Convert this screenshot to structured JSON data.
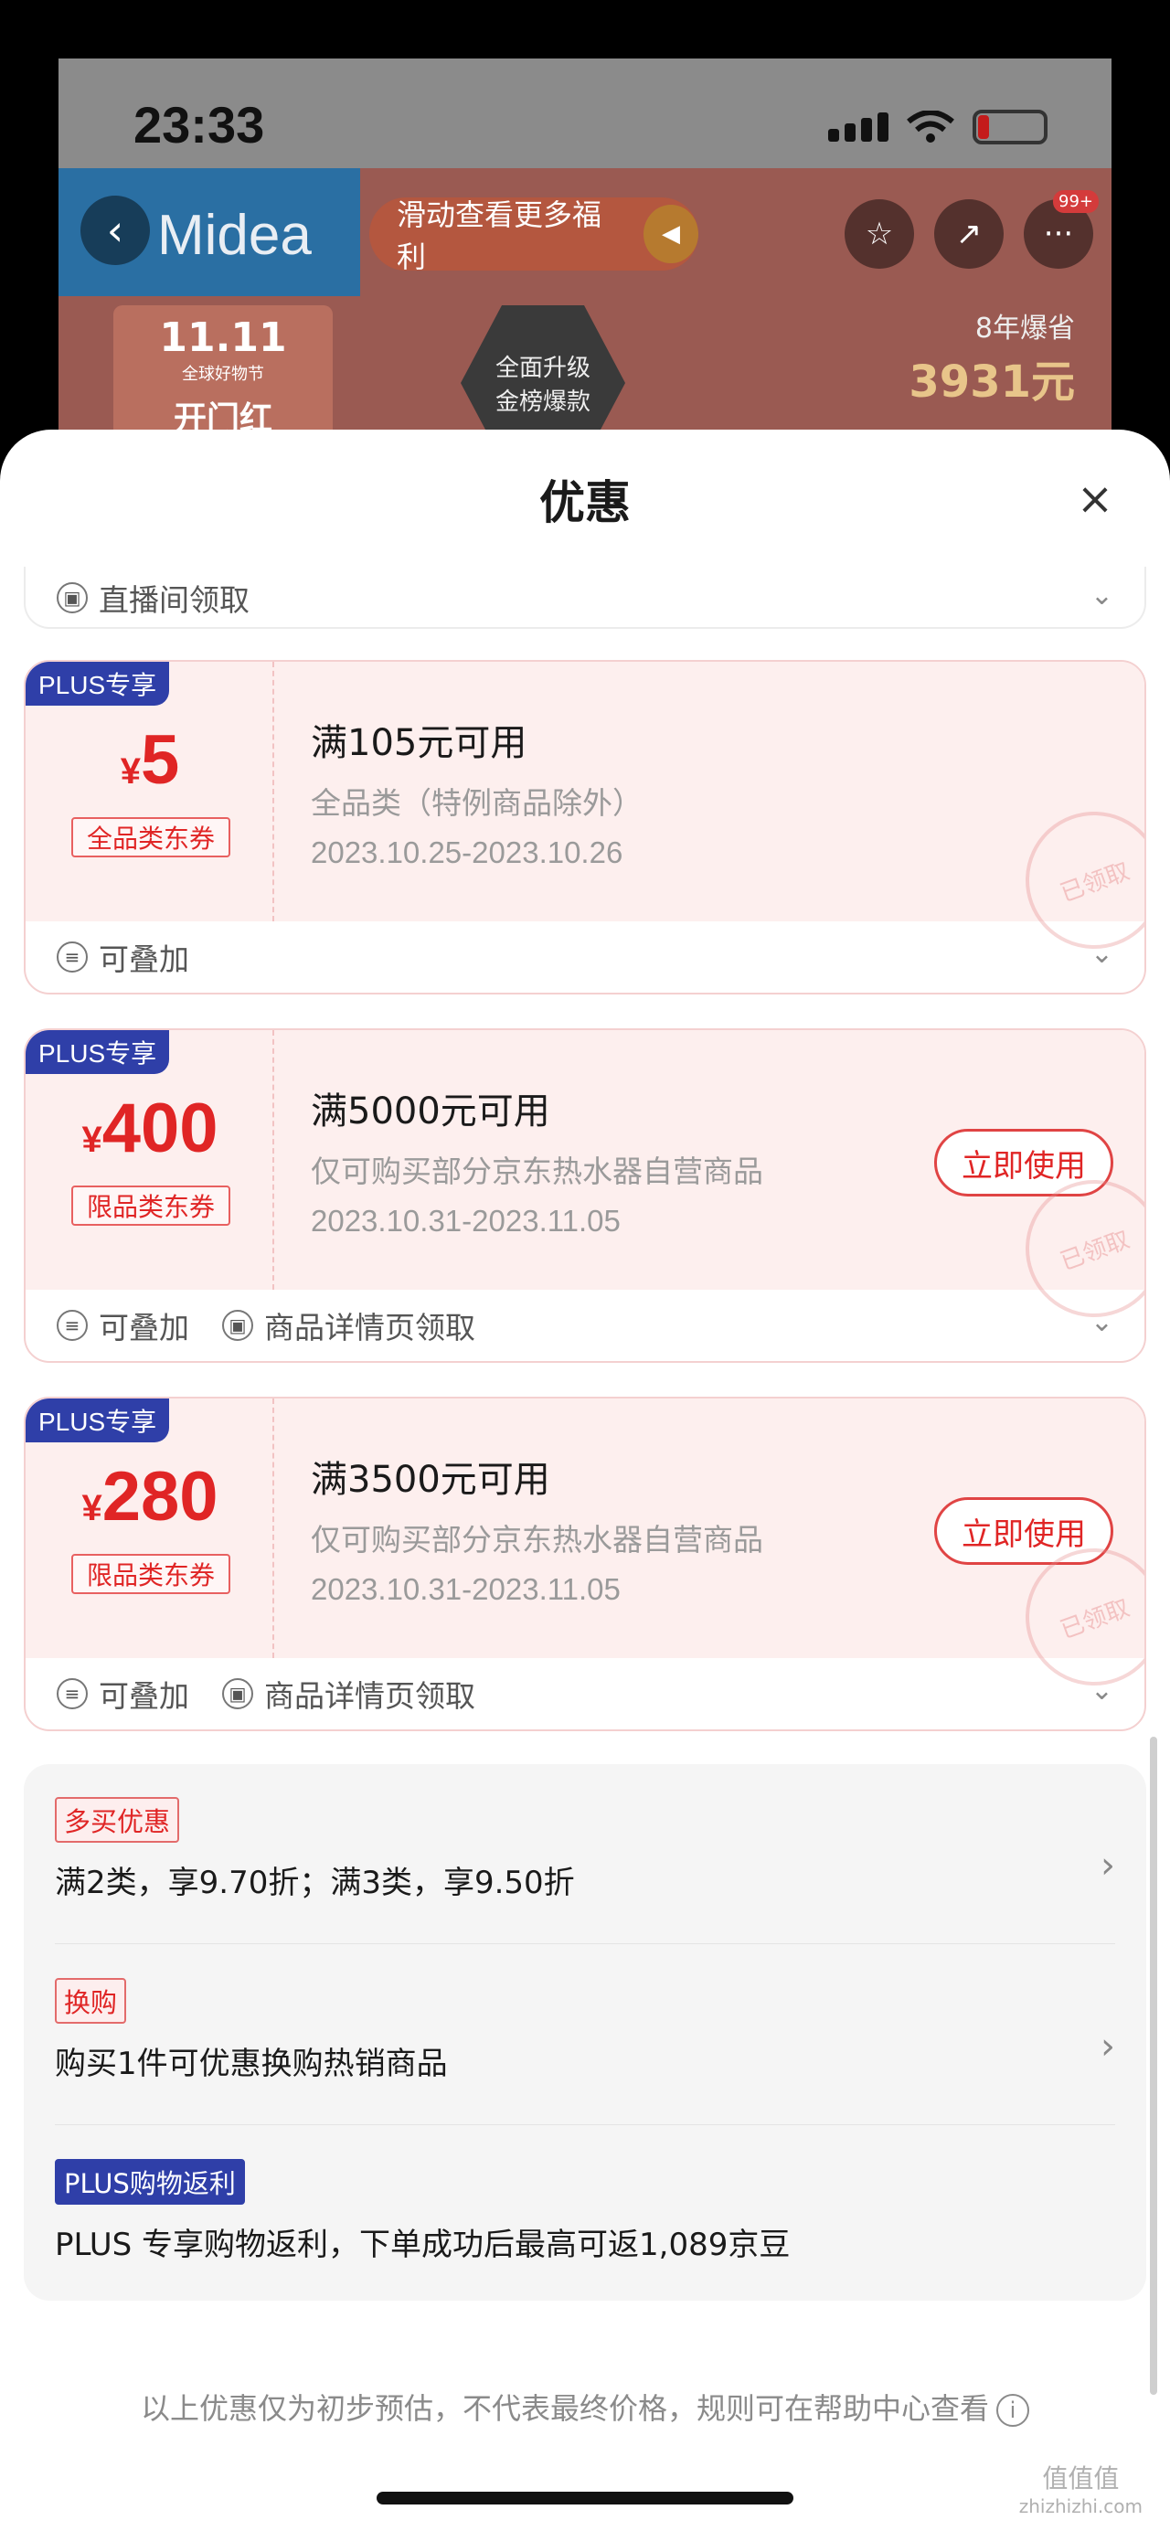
{
  "status_bar": {
    "time": "23:33"
  },
  "background_page": {
    "brand": "Midea",
    "banner_tag": "滑动查看更多福利",
    "badge_count": "99+",
    "event_logo": "11.11",
    "event_sub": "全球好物节",
    "event_title": "开门红",
    "hex_badge_line1": "全面升级",
    "hex_badge_line2": "金榜爆款",
    "save_label": "8年爆省",
    "save_value": "3931元"
  },
  "sheet": {
    "title": "优惠",
    "top_partial": {
      "label": "直播间领取"
    },
    "coupons": [
      {
        "plus": "PLUS专享",
        "currency": "¥",
        "amount": "5",
        "category": "全品类东券",
        "condition": "满105元可用",
        "scope": "全品类（特例商品除外）",
        "date": "2023.10.25-2023.10.26",
        "stamp": "已领取",
        "meta": [
          "可叠加"
        ]
      },
      {
        "plus": "PLUS专享",
        "currency": "¥",
        "amount": "400",
        "category": "限品类东券",
        "condition": "满5000元可用",
        "scope": "仅可购买部分京东热水器自营商品",
        "date": "2023.10.31-2023.11.05",
        "button": "立即使用",
        "stamp": "已领取",
        "meta": [
          "可叠加",
          "商品详情页领取"
        ]
      },
      {
        "plus": "PLUS专享",
        "currency": "¥",
        "amount": "280",
        "category": "限品类东券",
        "condition": "满3500元可用",
        "scope": "仅可购买部分京东热水器自营商品",
        "date": "2023.10.31-2023.11.05",
        "button": "立即使用",
        "stamp": "已领取",
        "meta": [
          "可叠加",
          "商品详情页领取"
        ]
      }
    ],
    "promos": [
      {
        "tag": "多买优惠",
        "text": "满2类，享9.70折；满3类，享9.50折"
      },
      {
        "tag": "换购",
        "text": "购买1件可优惠换购热销商品"
      },
      {
        "tag": "PLUS购物返利",
        "text": "PLUS 专享购物返利，下单成功后最高可返1,089京豆"
      }
    ],
    "footer_note": "以上优惠仅为初步预估，不代表最终价格，规则可在帮助中心查看"
  },
  "watermark": {
    "line1": "值值值",
    "line2": "zhizhizhi.com"
  }
}
